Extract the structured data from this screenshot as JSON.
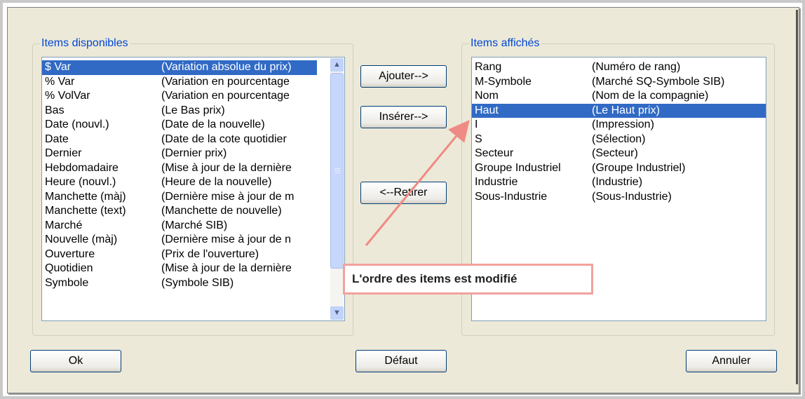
{
  "available": {
    "legend": "Items disponibles",
    "items": [
      {
        "name": "$ Var",
        "desc": "(Variation absolue du prix)"
      },
      {
        "name": "% Var",
        "desc": "(Variation en pourcentage"
      },
      {
        "name": "% VolVar",
        "desc": "(Variation en pourcentage"
      },
      {
        "name": "Bas",
        "desc": "(Le Bas prix)"
      },
      {
        "name": "Date (nouvl.)",
        "desc": "(Date de la nouvelle)"
      },
      {
        "name": "Date",
        "desc": "(Date de la cote quotidier"
      },
      {
        "name": "Dernier",
        "desc": "(Dernier prix)"
      },
      {
        "name": "Hebdomadaire",
        "desc": "(Mise à jour de la dernière"
      },
      {
        "name": "Heure (nouvl.)",
        "desc": "(Heure de la nouvelle)"
      },
      {
        "name": "Manchette (màj)",
        "desc": "(Dernière mise à jour de m"
      },
      {
        "name": "Manchette (text)",
        "desc": "(Manchette de nouvelle)"
      },
      {
        "name": "Marché",
        "desc": "(Marché SIB)"
      },
      {
        "name": "Nouvelle (màj)",
        "desc": "(Dernière mise à jour de n"
      },
      {
        "name": "Ouverture",
        "desc": "(Prix de l'ouverture)"
      },
      {
        "name": "Quotidien",
        "desc": "(Mise à jour de la dernière"
      },
      {
        "name": "Symbole",
        "desc": "(Symbole SIB)"
      }
    ],
    "selected_index": 0
  },
  "displayed": {
    "legend": "Items affichés",
    "items": [
      {
        "name": "Rang",
        "desc": "(Numéro de rang)"
      },
      {
        "name": "M-Symbole",
        "desc": "(Marché SQ-Symbole SIB)"
      },
      {
        "name": "Nom",
        "desc": "(Nom de la compagnie)"
      },
      {
        "name": "Haut",
        "desc": "(Le Haut prix)"
      },
      {
        "name": "I",
        "desc": "(Impression)"
      },
      {
        "name": "S",
        "desc": "(Sélection)"
      },
      {
        "name": "Secteur",
        "desc": "(Secteur)"
      },
      {
        "name": "Groupe Industriel",
        "desc": "(Groupe Industriel)"
      },
      {
        "name": "Industrie",
        "desc": "(Industrie)"
      },
      {
        "name": "Sous-Industrie",
        "desc": "(Sous-Industrie)"
      }
    ],
    "selected_index": 3
  },
  "buttons": {
    "add": "Ajouter-->",
    "insert": "Insérer-->",
    "remove": "<--Retirer",
    "ok": "Ok",
    "default": "Défaut",
    "cancel": "Annuler"
  },
  "callout": {
    "text": "L'ordre des items est modifié"
  },
  "icons": {
    "scroll_up": "chevron-up-icon",
    "scroll_down": "chevron-down-icon"
  },
  "colors": {
    "selection": "#316ac5",
    "legend": "#0046d5",
    "callout_border": "#f2a19e",
    "arrow": "#f08a84"
  }
}
